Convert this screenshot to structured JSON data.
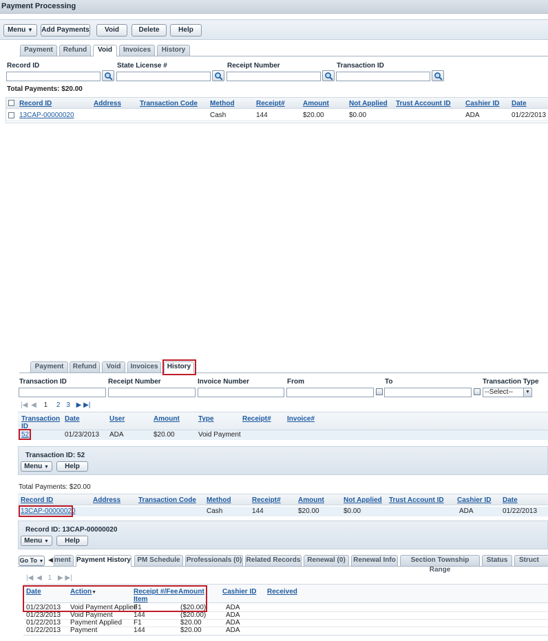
{
  "window": {
    "title": "Payment Processing"
  },
  "toolbar": {
    "menu_label": "Menu",
    "add_payments_label": "Add Payments",
    "void_label": "Void",
    "delete_label": "Delete",
    "help_label": "Help"
  },
  "top_tabs": [
    "Payment",
    "Refund",
    "Void",
    "Invoices",
    "History"
  ],
  "top_active_tab": "Void",
  "search": {
    "record_id_label": "Record ID",
    "state_license_label": "State License #",
    "receipt_number_label": "Receipt Number",
    "transaction_id_label": "Transaction ID"
  },
  "void_panel": {
    "total_payments": "Total Payments:  $20.00",
    "columns": [
      "Record ID",
      "Address",
      "Transaction Code",
      "Method",
      "Receipt#",
      "Amount",
      "Not Applied",
      "Trust Account ID",
      "Cashier ID",
      "Date"
    ],
    "row": {
      "record_id": "13CAP-00000020",
      "method": "Cash",
      "receipt": "144",
      "amount": "$20.00",
      "not_applied": "$0.00",
      "cashier": "ADA",
      "date": "01/22/2013"
    }
  },
  "bottom_tabs": [
    "Payment",
    "Refund",
    "Void",
    "Invoices",
    "History"
  ],
  "bottom_active_tab": "History",
  "history_filters": {
    "transaction_id_label": "Transaction ID",
    "receipt_number_label": "Receipt Number",
    "invoice_number_label": "Invoice Number",
    "from_label": "From",
    "to_label": "To",
    "transaction_type_label": "Transaction Type",
    "transaction_type_value": "--Select--"
  },
  "pager_top": {
    "pages": [
      "1",
      "2",
      "3"
    ]
  },
  "history_table": {
    "columns": [
      "Transaction ID",
      "Date",
      "User",
      "Amount",
      "Type",
      "Receipt#",
      "Invoice#"
    ],
    "col0_line1": "Transaction",
    "col0_line2": "ID",
    "row": {
      "transaction_id": "52",
      "date": "01/23/2013",
      "user": "ADA",
      "amount": "$20.00",
      "type": "Void Payment"
    }
  },
  "transaction_panel": {
    "title": "Transaction ID: 52",
    "menu_label": "Menu",
    "help_label": "Help"
  },
  "payments_panel": {
    "total_payments": "Total Payments:  $20.00",
    "columns": [
      "Record ID",
      "Address",
      "Transaction Code",
      "Method",
      "Receipt#",
      "Amount",
      "Not Applied",
      "Trust Account ID",
      "Cashier ID",
      "Date"
    ],
    "row": {
      "record_id": "13CAP-00000020",
      "method": "Cash",
      "receipt": "144",
      "amount": "$20.00",
      "not_applied": "$0.00",
      "cashier": "ADA",
      "date": "01/22/2013"
    }
  },
  "record_panel": {
    "title": "Record ID: 13CAP-00000020",
    "menu_label": "Menu",
    "help_label": "Help"
  },
  "record_tabs": {
    "goto_label": "Go To",
    "partial_tab": "ment",
    "tabs": [
      "Payment History",
      "PM Schedule",
      "Professionals (0)",
      "Related Records",
      "Renewal (0)",
      "Renewal Info",
      "Section Township Range",
      "Status",
      "Struct"
    ],
    "active_tab": "Payment History"
  },
  "pager_bottom": {
    "pages": [
      "1"
    ]
  },
  "payment_history": {
    "columns": [
      "Date",
      "Action",
      "Receipt #/Fee Item",
      "Amount",
      "Cashier ID",
      "Received"
    ],
    "col2_line1": "Receipt #/Fee",
    "col2_line2": "Item",
    "rows": [
      {
        "date": "01/23/2013",
        "action": "Void Payment Applied",
        "receipt": "F1",
        "amount": "($20.00)",
        "cashier": "ADA"
      },
      {
        "date": "01/23/2013",
        "action": "Void Payment",
        "receipt": "144",
        "amount": "($20.00)",
        "cashier": "ADA"
      },
      {
        "date": "01/22/2013",
        "action": "Payment Applied",
        "receipt": "F1",
        "amount": "$20.00",
        "cashier": "ADA"
      },
      {
        "date": "01/22/2013",
        "action": "Payment",
        "receipt": "144",
        "amount": "$20.00",
        "cashier": "ADA"
      }
    ]
  }
}
